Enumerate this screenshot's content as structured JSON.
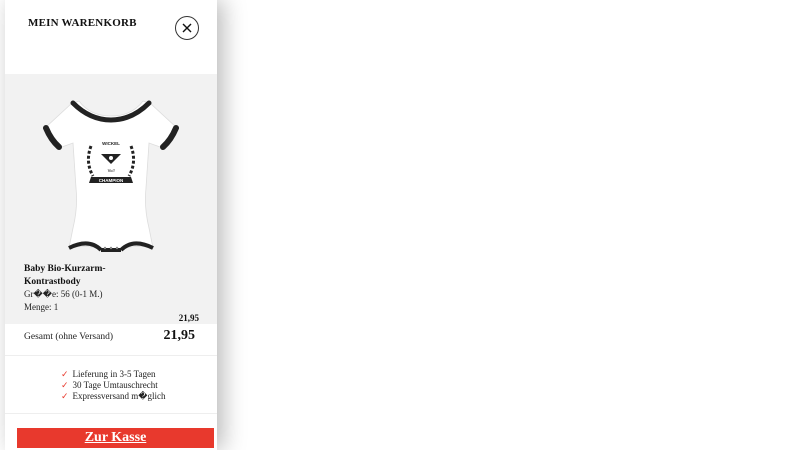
{
  "cart": {
    "title": "MEIN WARENKORB",
    "close_icon": "close-icon"
  },
  "item": {
    "name": "Baby Bio-Kurzarm-Kontrastbody",
    "size": "Gr��e: 56 (0-1 M.)",
    "quantity": "Menge: 1",
    "price": "21,95",
    "print": {
      "top_text": "WICKEL",
      "middle_text": "Wall",
      "banner_text": "CHAMPION"
    }
  },
  "summary": {
    "total_label": "Gesamt (ohne Versand)",
    "total_value": "21,95"
  },
  "benefits": [
    "Lieferung in 3-5 Tagen",
    "30 Tage Umtauschrecht",
    "Expressversand m�glich"
  ],
  "checkout": {
    "label": "Zur Kasse"
  },
  "colors": {
    "accent": "#e8392d",
    "item_background": "#f2f2f2"
  }
}
